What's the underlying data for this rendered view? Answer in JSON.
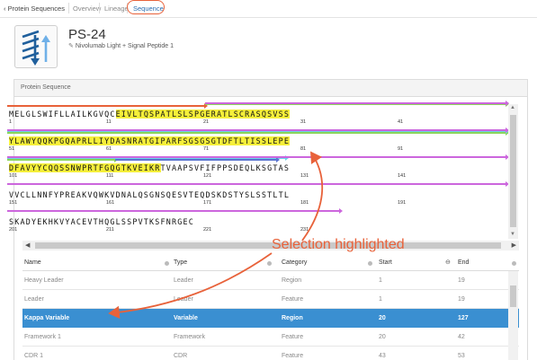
{
  "tabs": {
    "back": "‹ Protein Sequences",
    "overview": "Overview",
    "lineage": "Lineage",
    "sequence": "Sequence"
  },
  "header": {
    "title": "PS-24",
    "subtitle": "Nivolumab Light + Signal Peptide 1"
  },
  "panel": {
    "title": "Protein Sequence"
  },
  "sequence_lines": [
    {
      "pre": "MELGLSWIFLLAILKGVQC",
      "hl": "EIVLTQSPATLSLSPGERATLSCRASQSVSS",
      "post": "",
      "numbers": [
        "1",
        "11",
        "21",
        "31",
        "41"
      ]
    },
    {
      "pre": "",
      "hl": "YLAWYQQKPGQAPRLLIYDASNRATGIPARFSGSGSGTDFTLTISSLEPE",
      "post": "",
      "numbers": [
        "51",
        "61",
        "71",
        "81",
        "91"
      ]
    },
    {
      "pre": "",
      "hl": "DFAVYYCQQSSNWPRTFGQGTKVEIKR",
      "post": "TVAAPSVFIFPPSDEQLKSGTAS",
      "numbers": [
        "101",
        "111",
        "121",
        "131",
        "141"
      ]
    },
    {
      "pre": "VVCLLNNFYPREAKVQWKVDNALQSGNSQESVTEQDSKDSTYSLSSTLTL",
      "hl": "",
      "post": "",
      "numbers": [
        "151",
        "161",
        "171",
        "181",
        "191"
      ]
    },
    {
      "pre": "SKADYEKHKVYACEVTHQGLSSPVTKSFNRGEC",
      "hl": "",
      "post": "",
      "numbers": [
        "201",
        "211",
        "221",
        "231"
      ]
    }
  ],
  "grid": {
    "columns": [
      "Name",
      "Type",
      "Category",
      "Start",
      "End"
    ],
    "rows": [
      {
        "name": "Heavy Leader",
        "type": "Leader",
        "category": "Region",
        "start": "1",
        "end": "19"
      },
      {
        "name": "Leader",
        "type": "Leader",
        "category": "Feature",
        "start": "1",
        "end": "19"
      },
      {
        "name": "Kappa Variable",
        "type": "Variable",
        "category": "Region",
        "start": "20",
        "end": "127"
      },
      {
        "name": "Framework 1",
        "type": "Framework",
        "category": "Feature",
        "start": "20",
        "end": "42"
      },
      {
        "name": "CDR 1",
        "type": "CDR",
        "category": "Feature",
        "start": "43",
        "end": "53"
      }
    ],
    "selected_index": 2
  },
  "annotation": {
    "text": "Selection highlighted"
  },
  "colors": {
    "highlight": "#f5ef3a",
    "selection": "#3a8fd1",
    "annotation": "#e8623a"
  }
}
